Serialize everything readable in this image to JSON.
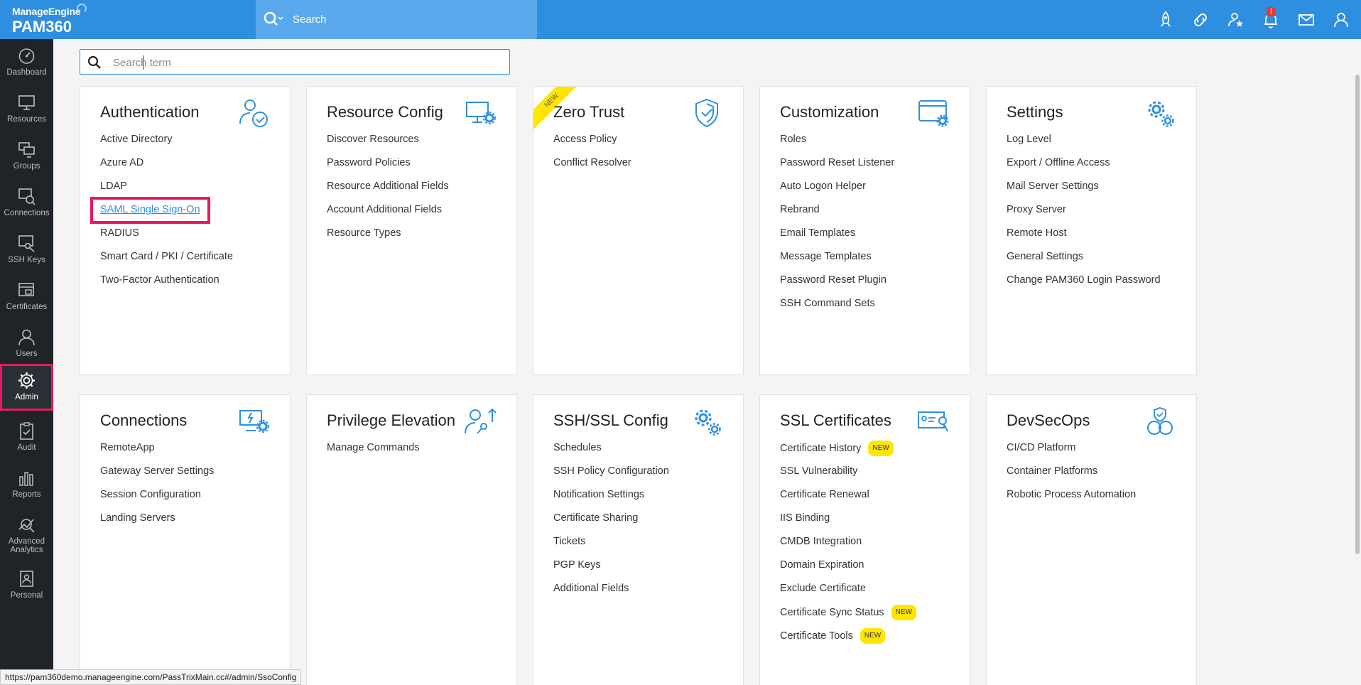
{
  "brand": {
    "small": "ManageEngine",
    "big": "PAM360"
  },
  "top_search": {
    "label": "Search"
  },
  "top_icons": [
    "rocket-icon",
    "link-icon",
    "star-user-icon",
    "bell-icon",
    "mail-icon",
    "user-icon"
  ],
  "notification_count": "!",
  "sidebar": {
    "items": [
      {
        "label": "Dashboard",
        "icon": "dashboard-icon"
      },
      {
        "label": "Resources",
        "icon": "monitor-icon"
      },
      {
        "label": "Groups",
        "icon": "groups-icon"
      },
      {
        "label": "Connections",
        "icon": "connections-icon"
      },
      {
        "label": "SSH Keys",
        "icon": "ssh-key-icon"
      },
      {
        "label": "Certificates",
        "icon": "certificate-icon"
      },
      {
        "label": "Users",
        "icon": "user-icon"
      },
      {
        "label": "Admin",
        "icon": "gear-icon"
      },
      {
        "label": "Audit",
        "icon": "clipboard-icon"
      },
      {
        "label": "Reports",
        "icon": "bar-chart-icon"
      },
      {
        "label": "Advanced Analytics",
        "icon": "analytics-icon"
      },
      {
        "label": "Personal",
        "icon": "personal-icon"
      }
    ],
    "active": "Admin"
  },
  "search": {
    "placeholder": "Search term",
    "value": ""
  },
  "new_label": "NEW",
  "cards": {
    "authentication": {
      "title": "Authentication",
      "items": [
        "Active Directory",
        "Azure AD",
        "LDAP",
        "SAML Single Sign-On",
        "RADIUS",
        "Smart Card / PKI / Certificate",
        "Two-Factor Authentication"
      ]
    },
    "resource_config": {
      "title": "Resource Config",
      "items": [
        "Discover Resources",
        "Password Policies",
        "Resource Additional Fields",
        "Account Additional Fields",
        "Resource Types"
      ]
    },
    "zero_trust": {
      "title": "Zero Trust",
      "items": [
        "Access Policy",
        "Conflict Resolver"
      ]
    },
    "customization": {
      "title": "Customization",
      "items": [
        "Roles",
        "Password Reset Listener",
        "Auto Logon Helper",
        "Rebrand",
        "Email Templates",
        "Message Templates",
        "Password Reset Plugin",
        "SSH Command Sets"
      ]
    },
    "settings": {
      "title": "Settings",
      "items": [
        "Log Level",
        "Export / Offline Access",
        "Mail Server Settings",
        "Proxy Server",
        "Remote Host",
        "General Settings",
        "Change PAM360 Login Password"
      ]
    },
    "connections": {
      "title": "Connections",
      "items": [
        "RemoteApp",
        "Gateway Server Settings",
        "Session Configuration",
        "Landing Servers"
      ]
    },
    "privilege_elevation": {
      "title": "Privilege Elevation",
      "items": [
        "Manage Commands"
      ]
    },
    "ssh_ssl_config": {
      "title": "SSH/SSL Config",
      "items": [
        "Schedules",
        "SSH Policy Configuration",
        "Notification Settings",
        "Certificate Sharing",
        "Tickets",
        "PGP Keys",
        "Additional Fields"
      ]
    },
    "ssl_certificates": {
      "title": "SSL Certificates",
      "items": [
        "Certificate History",
        "SSL Vulnerability",
        "Certificate Renewal",
        "IIS Binding",
        "CMDB Integration",
        "Domain Expiration",
        "Exclude Certificate",
        "Certificate Sync Status",
        "Certificate Tools"
      ]
    },
    "devsecops": {
      "title": "DevSecOps",
      "items": [
        "CI/CD Platform",
        "Container Platforms",
        "Robotic Process Automation"
      ]
    }
  },
  "status_url": "https://pam360demo.manageengine.com/PassTrixMain.cc#/admin/SsoConfig",
  "colors": {
    "topbar": "#2e8fe0",
    "sidebar": "#1f2429",
    "accent": "#2e8fe0",
    "highlight": "#e8195e",
    "new_badge": "#ffe600"
  }
}
